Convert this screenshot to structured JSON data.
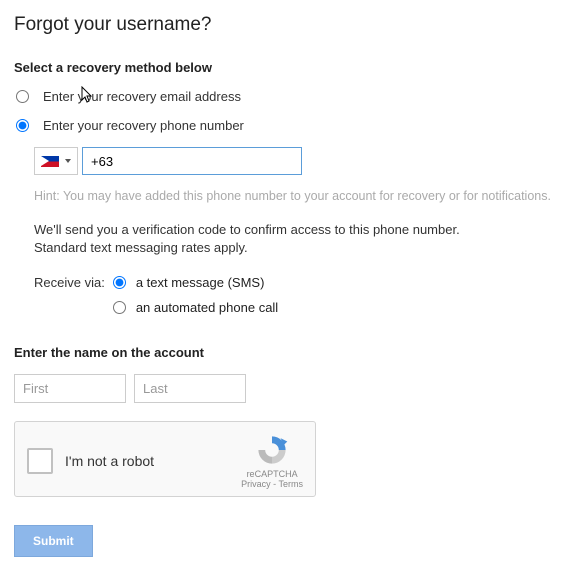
{
  "title": "Forgot your username?",
  "section_recovery": "Select a recovery method below",
  "recovery": {
    "email_label": "Enter your recovery email address",
    "phone_label": "Enter your recovery phone number"
  },
  "phone": {
    "value": "+63",
    "hint": "Hint: You may have added this phone number to your account for recovery or for notifications.",
    "explain_line1": "We'll send you a verification code to confirm access to this phone number.",
    "explain_line2": "Standard text messaging rates apply."
  },
  "receive": {
    "label": "Receive via:",
    "sms": "a text message (SMS)",
    "call": "an automated phone call"
  },
  "name": {
    "heading": "Enter the name on the account",
    "first_placeholder": "First",
    "last_placeholder": "Last"
  },
  "recaptcha": {
    "label": "I'm not a robot",
    "brand": "reCAPTCHA",
    "links": "Privacy - Terms"
  },
  "submit_label": "Submit"
}
